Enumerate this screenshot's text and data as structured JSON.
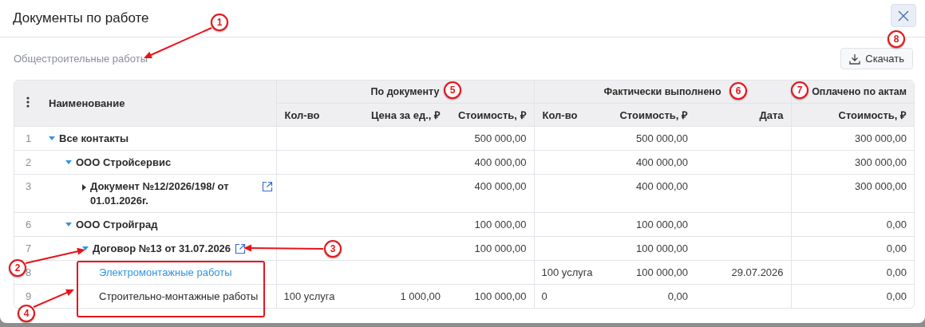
{
  "dialog": {
    "title": "Документы по работе",
    "subtitle": "Общестроительные работы",
    "download_button": "Скачать"
  },
  "table": {
    "name_column": "Наименование",
    "groups": [
      {
        "label": "По документу",
        "columns": [
          "Кол-во",
          "Цена за ед., ₽",
          "Стоимость, ₽"
        ]
      },
      {
        "label": "Фактически выполнено",
        "columns": [
          "Кол-во",
          "Стоимость, ₽",
          "Дата"
        ]
      },
      {
        "label": "Оплачено по актам",
        "columns": [
          "Стоимость, ₽"
        ]
      }
    ],
    "rows": [
      {
        "number": "1",
        "name": "Все контакты",
        "expanded": true,
        "external_link": false,
        "highlighted": false,
        "values": {
          "doc_cost": "500 000,00",
          "fact_cost": "500 000,00",
          "paid_cost": "300 000,00"
        },
        "children": [
          {
            "number": "2",
            "name": "ООО Стройсервис",
            "expanded": true,
            "external_link": false,
            "highlighted": false,
            "values": {
              "doc_cost": "400 000,00",
              "fact_cost": "400 000,00",
              "paid_cost": "300 000,00"
            },
            "children": [
              {
                "number": "3",
                "name": "Документ №12/2026/198/ от 01.01.2026г.",
                "expanded": false,
                "external_link": true,
                "highlighted": false,
                "values": {
                  "doc_cost": "400 000,00",
                  "fact_cost": "400 000,00",
                  "paid_cost": "300 000,00"
                }
              }
            ]
          },
          {
            "number": "6",
            "name": "ООО Стройград",
            "expanded": true,
            "external_link": false,
            "highlighted": false,
            "values": {
              "doc_cost": "100 000,00",
              "fact_cost": "100 000,00",
              "paid_cost": "0,00"
            },
            "children": [
              {
                "number": "7",
                "name": "Договор №13 от 31.07.2026",
                "expanded": true,
                "external_link": true,
                "highlighted": false,
                "values": {
                  "doc_cost": "100 000,00",
                  "fact_cost": "100 000,00",
                  "paid_cost": "0,00"
                },
                "children": [
                  {
                    "number": "8",
                    "name": "Электромонтажные работы",
                    "external_link": false,
                    "highlighted": true,
                    "values": {
                      "fact_qty": "100 услуга",
                      "fact_cost": "100 000,00",
                      "fact_date": "29.07.2026",
                      "paid_cost": "0,00"
                    }
                  },
                  {
                    "number": "9",
                    "name": "Строительно-монтажные работы",
                    "external_link": false,
                    "highlighted": false,
                    "values": {
                      "doc_qty": "100 услуга",
                      "doc_price": "1 000,00",
                      "doc_cost": "100 000,00",
                      "fact_qty": "0",
                      "fact_cost": "0,00",
                      "paid_cost": "0,00"
                    }
                  }
                ]
              }
            ]
          }
        ]
      }
    ]
  },
  "annotations": [
    {
      "label": "1"
    },
    {
      "label": "2"
    },
    {
      "label": "3"
    },
    {
      "label": "4"
    },
    {
      "label": "5"
    },
    {
      "label": "6"
    },
    {
      "label": "7"
    },
    {
      "label": "8"
    }
  ]
}
